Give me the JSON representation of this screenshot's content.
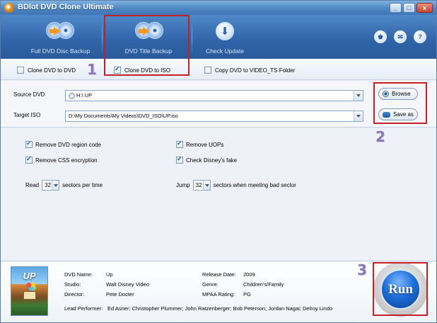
{
  "window": {
    "title": "BDlot DVD Clone Ultimate",
    "controls": [
      "_",
      "□",
      "x"
    ]
  },
  "toolbar": {
    "items": [
      {
        "label": "Full DVD Disc Backup",
        "icon": "disc-copy-icon"
      },
      {
        "label": "DVD Title Backup",
        "icon": "disc-title-icon"
      },
      {
        "label": "Check Update",
        "icon": "download-icon"
      }
    ],
    "right_buttons": [
      "user-icon",
      "mail-icon",
      "help-icon"
    ],
    "right_glyphs": [
      "♚",
      "✉",
      "?"
    ]
  },
  "modes": [
    {
      "label": "Clone DVD to DVD",
      "checked": false
    },
    {
      "label": "Clone DVD to ISO",
      "checked": true
    },
    {
      "label": "Copy DVD to VIDEO_TS Folder",
      "checked": false
    }
  ],
  "source": {
    "label": "Source DVD",
    "value": "H:\\ UP"
  },
  "target": {
    "label": "Target ISO",
    "value": "D:\\My Documents\\My Videos\\DVD_ISO\\UP.iso"
  },
  "buttons": {
    "browse": "Browse",
    "save_as": "Save as",
    "run": "Run"
  },
  "options": {
    "remove_region": {
      "label": "Remove DVD region code",
      "checked": true
    },
    "remove_css": {
      "label": "Remove CSS encryption",
      "checked": true
    },
    "remove_uops": {
      "label": "Remove UOPs",
      "checked": true
    },
    "check_disney": {
      "label": "Check Disney's fake",
      "checked": true
    },
    "read_prefix": "Read",
    "read_value": "32",
    "read_suffix": "sectors per time",
    "jump_prefix": "Jump",
    "jump_value": "32",
    "jump_suffix": "sectors when meeting bad sector"
  },
  "movie": {
    "poster_title": "UP",
    "dvd_name_label": "DVD Name:",
    "dvd_name": "Up",
    "studio_label": "Studio:",
    "studio": "Walt Disney Video",
    "director_label": "Director:",
    "director": "Pete Docter",
    "release_label": "Release Date:",
    "release": "2009",
    "genre_label": "Genre:",
    "genre": "Children's/Family",
    "mpaa_label": "MPAA Rating:",
    "mpaa": "PG",
    "performer_label": "Lead Performer:",
    "performer": "Ed Asner; Christopher Plummer; John Ratzenberger; Bob Peterson; Jordan Nagai; Delroy Lindo"
  },
  "annotations": {
    "step1": "1",
    "step2": "2",
    "step3": "3"
  },
  "colors": {
    "highlight_box": "#c51f27",
    "toolbar": "#2f64a8",
    "run_button": "#1f6fd8"
  }
}
